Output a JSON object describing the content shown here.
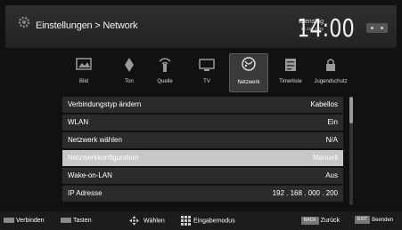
{
  "header": {
    "breadcrumb": "Einstellungen > Network",
    "day": "Dienstag",
    "date": "xx.xxx.xxxx",
    "time": "14:00",
    "settings_icon": "gear-icon"
  },
  "menu": [
    {
      "label": "Bild",
      "icon": "picture-icon",
      "selected": false
    },
    {
      "label": "Ton",
      "icon": "speaker-icon",
      "selected": false
    },
    {
      "label": "Quelle",
      "icon": "source-icon",
      "selected": false
    },
    {
      "label": "TV",
      "icon": "tv-icon",
      "selected": false
    },
    {
      "label": "Netzwerk",
      "icon": "network-globe-icon",
      "selected": true
    },
    {
      "label": "Timerliste",
      "icon": "timer-list-icon",
      "selected": false
    },
    {
      "label": "Jugendschutz",
      "icon": "parental-lock-icon",
      "selected": false
    }
  ],
  "settings": [
    {
      "key": "Verbindungstyp ändern",
      "value": "Kabellos",
      "highlighted": false
    },
    {
      "key": "WLAN",
      "value": "Ein",
      "highlighted": false
    },
    {
      "key": "Netzwerk wählen",
      "value": "N/A",
      "highlighted": false
    },
    {
      "key": "Netzwerkkonfiguration",
      "value": "Manuell",
      "highlighted": true
    },
    {
      "key": "Wake-on-LAN",
      "value": "Aus",
      "highlighted": false
    },
    {
      "key": "IP Adresse",
      "value": "192 . 168 . 000 . 200",
      "highlighted": false
    }
  ],
  "footer": {
    "connect": "Verbinden",
    "keys": "Tasten",
    "select": "Wählen",
    "input_mode": "Eingabemodus",
    "back_key": "BACK",
    "back": "Zurück",
    "exit_key": "EXIT",
    "exit": "Beenden"
  },
  "colors": {
    "highlight": "#c8c8c8",
    "row_bg": "#2b2b2b",
    "background": "#111111"
  }
}
